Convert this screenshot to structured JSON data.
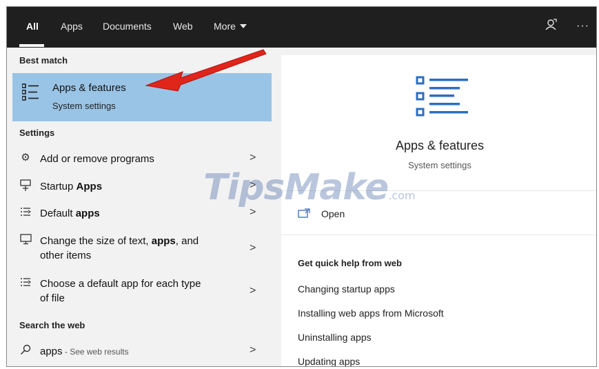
{
  "tabs": [
    {
      "label": "All",
      "active": true
    },
    {
      "label": "Apps"
    },
    {
      "label": "Documents"
    },
    {
      "label": "Web"
    },
    {
      "label": "More"
    }
  ],
  "topbar": {
    "feedback_icon": "feedback-icon",
    "more_options": "···"
  },
  "left": {
    "best_match_heading": "Best match",
    "best_match": {
      "title": "Apps & features",
      "subtitle": "System settings",
      "icon": "list-icon"
    },
    "settings_heading": "Settings",
    "settings": [
      {
        "icon": "gear-icon",
        "text_pre": "Add or remove programs",
        "text_bold": "",
        "text_post": ""
      },
      {
        "icon": "startup-icon",
        "text_pre": "Startup ",
        "text_bold": "Apps",
        "text_post": ""
      },
      {
        "icon": "default-apps-icon",
        "text_pre": "Default ",
        "text_bold": "apps",
        "text_post": ""
      },
      {
        "icon": "display-icon",
        "text_pre": "Change the size of text, ",
        "text_bold": "apps",
        "text_post": ", and",
        "line2": "other items"
      },
      {
        "icon": "default-apps-icon",
        "text_pre": "Choose a default app for each type",
        "text_bold": "",
        "text_post": "",
        "line2": "of file"
      }
    ],
    "web_heading": "Search the web",
    "web": {
      "query": "apps",
      "suffix": " - See web results",
      "icon": "search-icon"
    }
  },
  "right": {
    "title": "Apps & features",
    "subtitle": "System settings",
    "open_label": "Open",
    "help_heading": "Get quick help from web",
    "help_links": [
      "Changing startup apps",
      "Installing web apps from Microsoft",
      "Uninstalling apps",
      "Updating apps"
    ]
  },
  "watermark": {
    "brand": "TipsMake",
    "domain": ".com"
  },
  "colors": {
    "topbar": "#1f1f1f",
    "highlight": "#9ac4e6",
    "accent": "#2e6ec0",
    "arrow": "#e0251b"
  }
}
